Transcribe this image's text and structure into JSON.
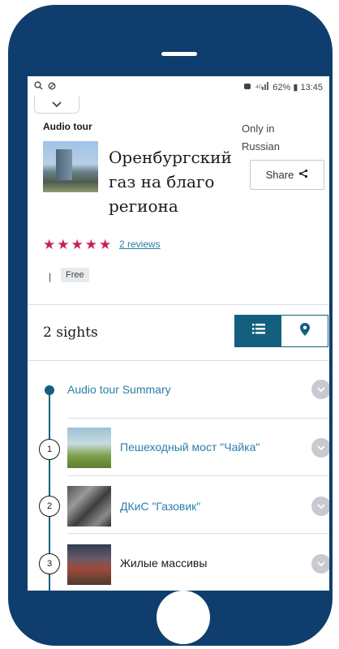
{
  "status_bar": {
    "right_text": "62% ▮ 13:45"
  },
  "header": {
    "type_label": "Audio tour",
    "title": "Оренбургский газ на благо региона",
    "language_note": "Only in Russian",
    "share_label": "Share"
  },
  "rating": {
    "stars": 5,
    "reviews_label": "2 reviews"
  },
  "price": {
    "pipe": "|",
    "badge": "Free"
  },
  "sights": {
    "count_label": "2 sights",
    "summary_label": "Audio tour Summary",
    "items": [
      {
        "number": "1",
        "name": "Пешеходный мост \"Чайка\""
      },
      {
        "number": "2",
        "name": "ДКиС \"Газовик\""
      },
      {
        "number": "3",
        "name": "Жилые массивы"
      }
    ]
  },
  "colors": {
    "phone_frame": "#0f3e6e",
    "accent": "#13607e",
    "link": "#2b7fa8",
    "star": "#c8214f"
  },
  "icons": [
    "search-icon",
    "status-circle-icon",
    "chevron-down-icon",
    "share-icon",
    "list-icon",
    "map-pin-icon"
  ]
}
